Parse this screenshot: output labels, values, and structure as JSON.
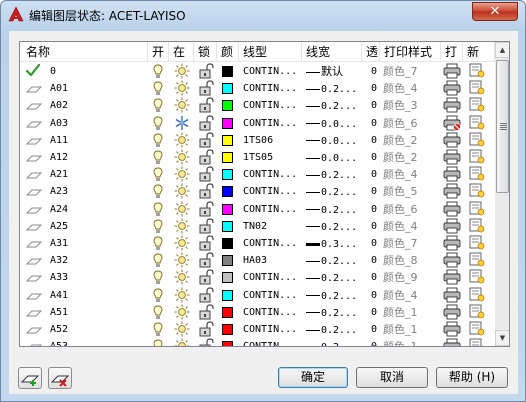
{
  "window": {
    "title": "编辑图层状态: ACET-LAYISO",
    "close_label": "✕"
  },
  "headers": {
    "name": "名称",
    "on": "开",
    "freeze": "在",
    "lock": "锁",
    "color": "颜",
    "linetype": "线型",
    "lineweight": "线宽",
    "transparency": "透",
    "plotstyle": "打印样式",
    "plot": "打",
    "newvp": "新"
  },
  "colors": {
    "white": "#ffffff",
    "cyan": "#00ffff",
    "green": "#00ff00",
    "magenta": "#ff00ff",
    "yellow": "#ffff00",
    "blue": "#0000ff",
    "black": "#000000",
    "grey": "#808080",
    "lightgrey": "#c0c0c0",
    "red": "#ff0000"
  },
  "rows": [
    {
      "name": "0",
      "current": true,
      "freeze": "sun",
      "color": "black",
      "linetype": "CONTIN...",
      "lineweight": "默认",
      "lw_thick": false,
      "transparency": "0",
      "plotstyle": "颜色_7",
      "no_plot": false
    },
    {
      "name": "A01",
      "current": false,
      "freeze": "sun",
      "color": "cyan",
      "linetype": "CONTIN...",
      "lineweight": "0.2...",
      "lw_thick": false,
      "transparency": "0",
      "plotstyle": "颜色_4",
      "no_plot": false
    },
    {
      "name": "A02",
      "current": false,
      "freeze": "sun",
      "color": "green",
      "linetype": "CONTIN...",
      "lineweight": "0.2...",
      "lw_thick": false,
      "transparency": "0",
      "plotstyle": "颜色_3",
      "no_plot": false
    },
    {
      "name": "A03",
      "current": false,
      "freeze": "snow",
      "color": "magenta",
      "linetype": "CONTIN...",
      "lineweight": "0.0...",
      "lw_thick": false,
      "transparency": "0",
      "plotstyle": "颜色_6",
      "no_plot": true
    },
    {
      "name": "A11",
      "current": false,
      "freeze": "sun",
      "color": "yellow",
      "linetype": "1TS06",
      "lineweight": "0.0...",
      "lw_thick": false,
      "transparency": "0",
      "plotstyle": "颜色_2",
      "no_plot": false
    },
    {
      "name": "A12",
      "current": false,
      "freeze": "sun",
      "color": "yellow",
      "linetype": "1TS05",
      "lineweight": "0.0...",
      "lw_thick": false,
      "transparency": "0",
      "plotstyle": "颜色_2",
      "no_plot": false
    },
    {
      "name": "A21",
      "current": false,
      "freeze": "sun",
      "color": "cyan",
      "linetype": "CONTIN...",
      "lineweight": "0.2...",
      "lw_thick": false,
      "transparency": "0",
      "plotstyle": "颜色_4",
      "no_plot": false
    },
    {
      "name": "A23",
      "current": false,
      "freeze": "sun",
      "color": "blue",
      "linetype": "CONTIN...",
      "lineweight": "0.2...",
      "lw_thick": false,
      "transparency": "0",
      "plotstyle": "颜色_5",
      "no_plot": false
    },
    {
      "name": "A24",
      "current": false,
      "freeze": "sun",
      "color": "magenta",
      "linetype": "CONTIN...",
      "lineweight": "0.2...",
      "lw_thick": false,
      "transparency": "0",
      "plotstyle": "颜色_6",
      "no_plot": false
    },
    {
      "name": "A25",
      "current": false,
      "freeze": "sun",
      "color": "cyan",
      "linetype": "TN02",
      "lineweight": "0.2...",
      "lw_thick": false,
      "transparency": "0",
      "plotstyle": "颜色_4",
      "no_plot": false
    },
    {
      "name": "A31",
      "current": false,
      "freeze": "sun",
      "color": "black",
      "linetype": "CONTIN...",
      "lineweight": "0.3...",
      "lw_thick": true,
      "transparency": "0",
      "plotstyle": "颜色_7",
      "no_plot": false
    },
    {
      "name": "A32",
      "current": false,
      "freeze": "sun",
      "color": "grey",
      "linetype": "HA03",
      "lineweight": "0.2...",
      "lw_thick": false,
      "transparency": "0",
      "plotstyle": "颜色_8",
      "no_plot": false
    },
    {
      "name": "A33",
      "current": false,
      "freeze": "sun",
      "color": "lightgrey",
      "linetype": "CONTIN...",
      "lineweight": "0.2...",
      "lw_thick": false,
      "transparency": "0",
      "plotstyle": "颜色_9",
      "no_plot": false
    },
    {
      "name": "A41",
      "current": false,
      "freeze": "sun",
      "color": "cyan",
      "linetype": "CONTIN...",
      "lineweight": "0.2...",
      "lw_thick": false,
      "transparency": "0",
      "plotstyle": "颜色_4",
      "no_plot": false
    },
    {
      "name": "A51",
      "current": false,
      "freeze": "sun",
      "color": "red",
      "linetype": "CONTIN...",
      "lineweight": "0.2...",
      "lw_thick": false,
      "transparency": "0",
      "plotstyle": "颜色_1",
      "no_plot": false
    },
    {
      "name": "A52",
      "current": false,
      "freeze": "sun",
      "color": "red",
      "linetype": "CONTIN...",
      "lineweight": "0.2...",
      "lw_thick": false,
      "transparency": "0",
      "plotstyle": "颜色_1",
      "no_plot": false
    },
    {
      "name": "A53",
      "current": false,
      "freeze": "sun",
      "color": "red",
      "linetype": "CONTIN...",
      "lineweight": "0.2...",
      "lw_thick": false,
      "transparency": "0",
      "plotstyle": "颜色_1",
      "no_plot": false
    }
  ],
  "buttons": {
    "ok": "确定",
    "cancel": "取消",
    "help": "帮助 (H)"
  },
  "icons": {
    "app": "autocad-logo-icon",
    "new_layer": "new-layer-icon",
    "delete_layer": "delete-layer-icon",
    "bulb": "lightbulb-on-icon",
    "sun": "sun-thawed-icon",
    "snow": "snowflake-frozen-icon",
    "lock": "unlocked-icon",
    "printer": "printer-icon",
    "newvp": "new-viewport-sun-icon"
  }
}
